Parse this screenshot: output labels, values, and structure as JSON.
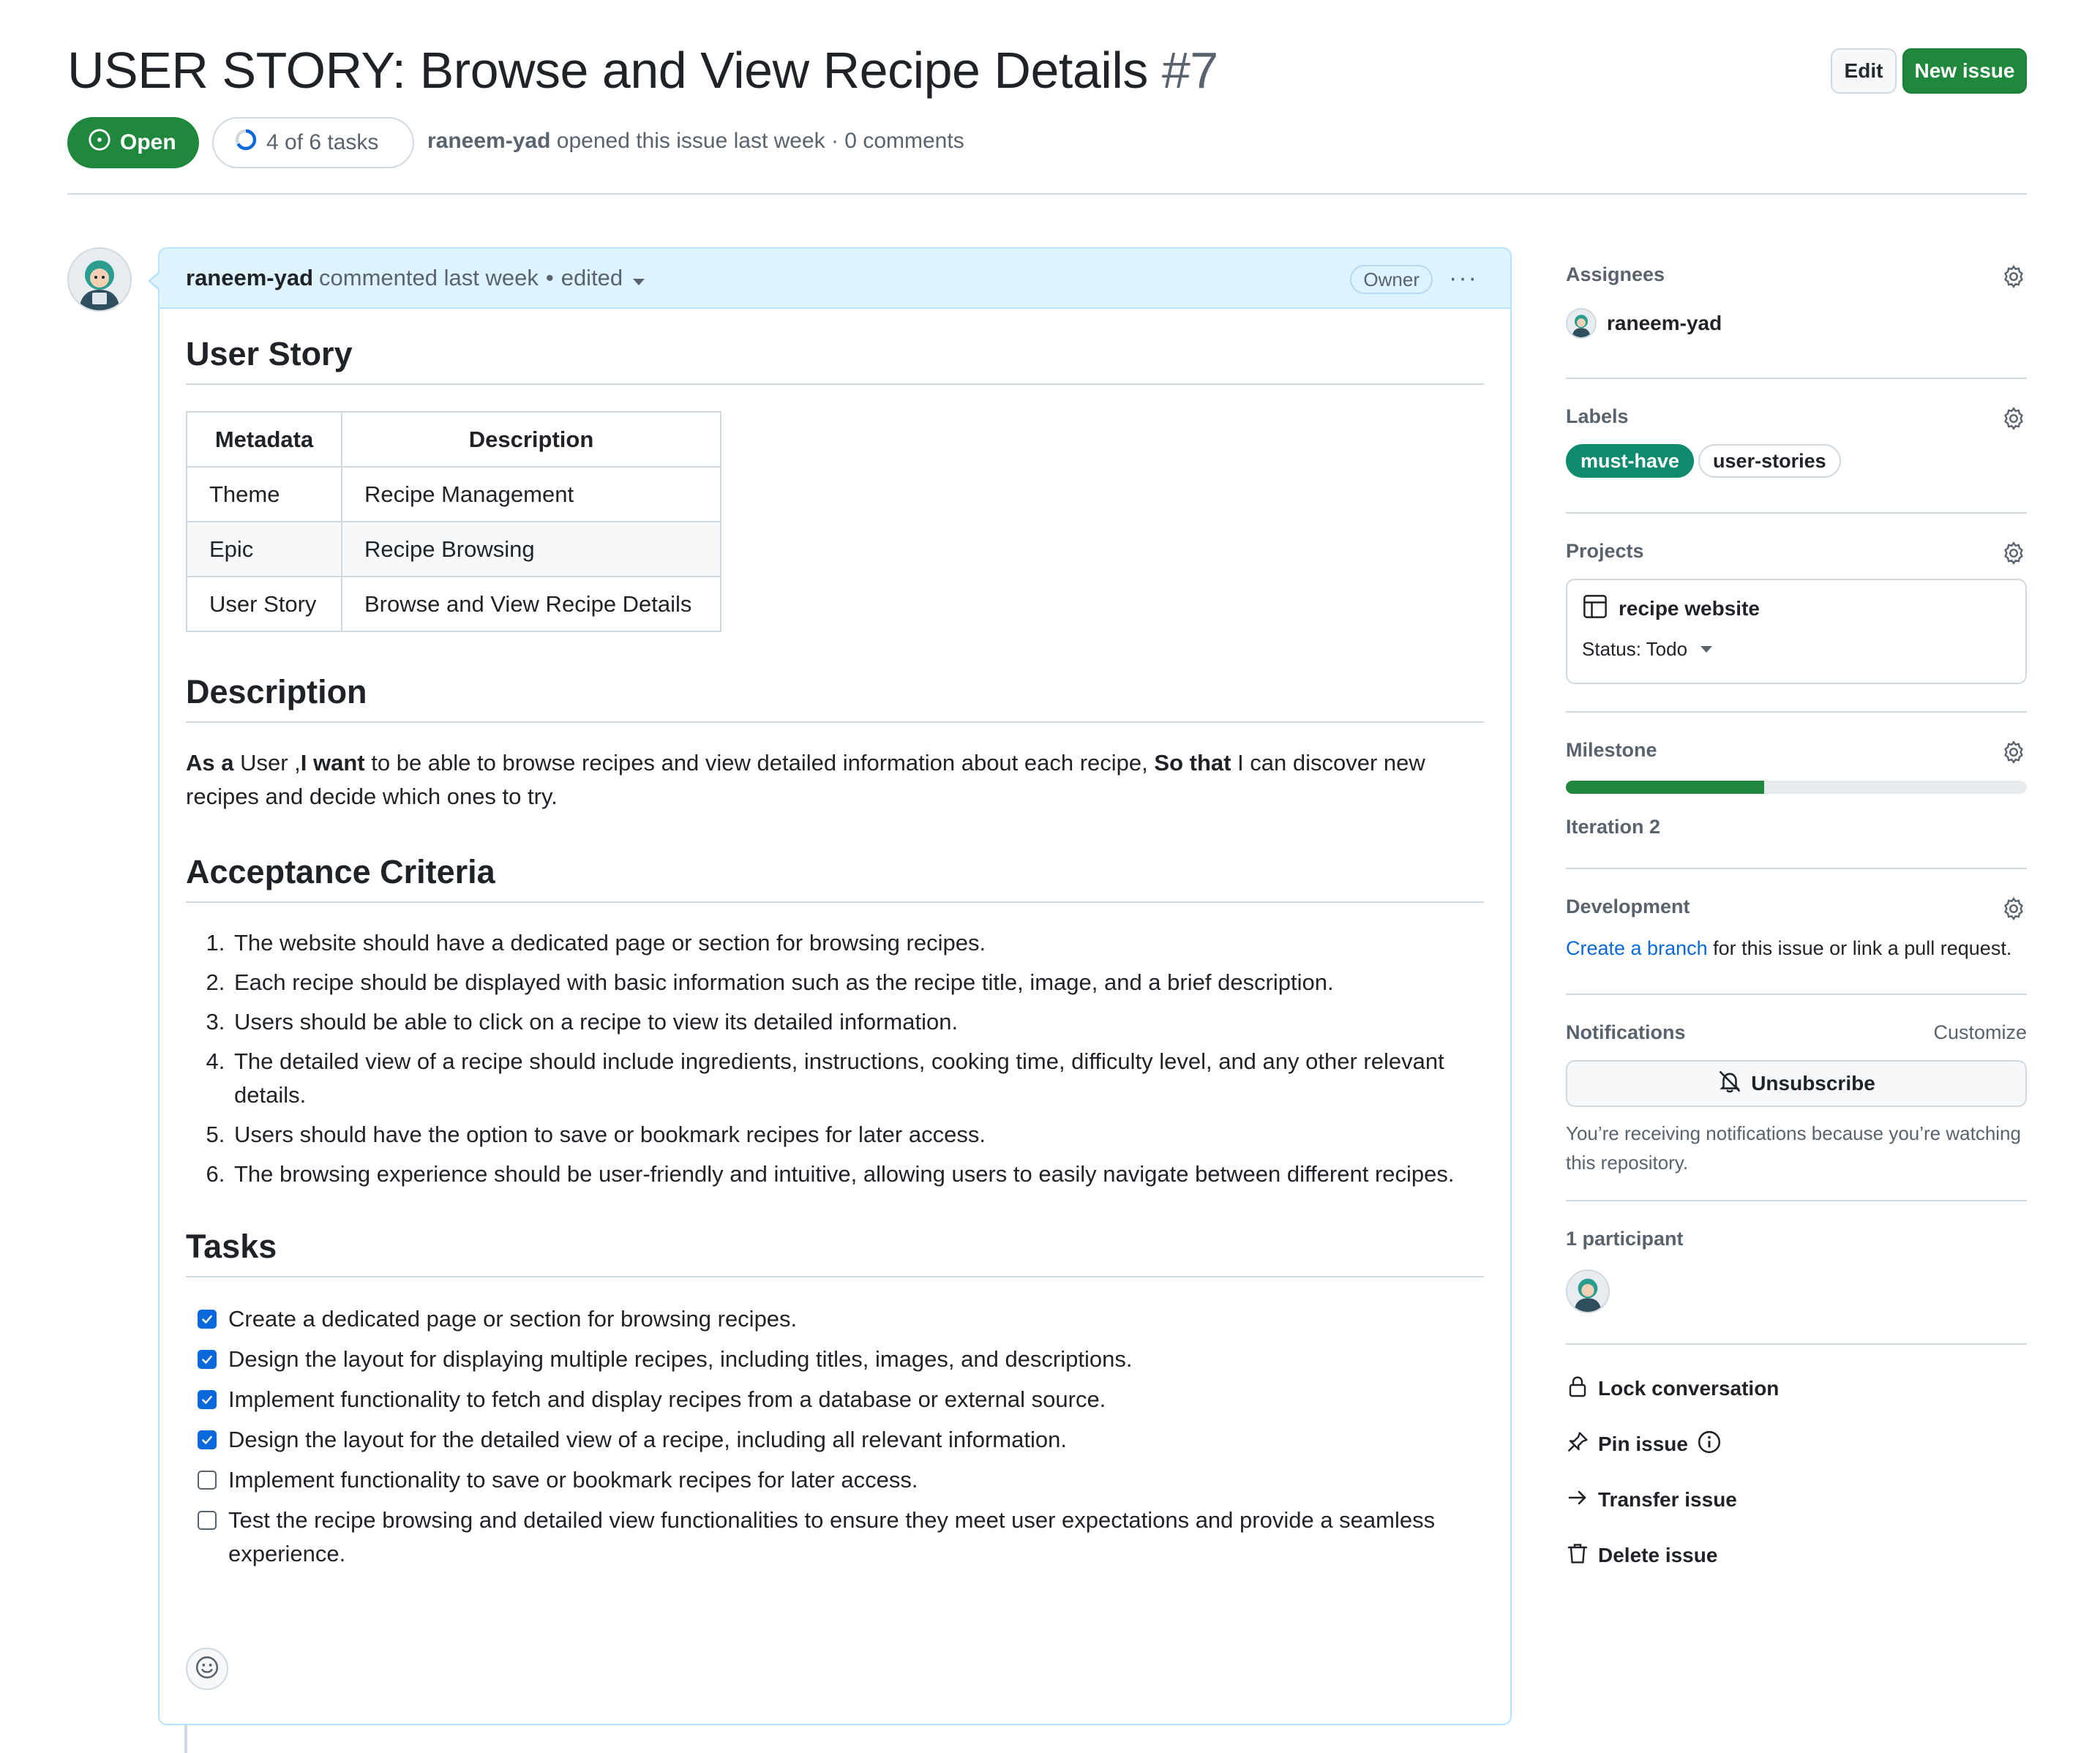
{
  "header": {
    "title": "USER STORY: Browse and View Recipe Details",
    "number": "#7",
    "edit_label": "Edit",
    "new_issue_label": "New issue",
    "state_label": "Open",
    "tasks_label": "4 of 6 tasks",
    "tasks_done": 4,
    "tasks_total": 6,
    "author": "raneem-yad",
    "opened_text": "opened this issue last week · 0 comments"
  },
  "comment": {
    "author": "raneem-yad",
    "time_text": "commented last week",
    "edited_label": "edited",
    "role_badge": "Owner",
    "more_label": "···",
    "user_story_heading": "User Story",
    "table": {
      "headers": [
        "Metadata",
        "Description"
      ],
      "rows": [
        [
          "Theme",
          "Recipe Management"
        ],
        [
          "Epic",
          "Recipe Browsing"
        ],
        [
          "User Story",
          "Browse and View Recipe Details"
        ]
      ]
    },
    "description_heading": "Description",
    "description": {
      "as_a": "As a",
      "role": " User ,",
      "i_want": "I want",
      "want_text": " to be able to browse recipes and view detailed information about each recipe, ",
      "so_that": "So that",
      "so_text": " I can discover new recipes and decide which ones to try."
    },
    "acceptance_heading": "Acceptance Criteria",
    "criteria": [
      "The website should have a dedicated page or section for browsing recipes.",
      "Each recipe should be displayed with basic information such as the recipe title, image, and a brief description.",
      "Users should be able to click on a recipe to view its detailed information.",
      "The detailed view of a recipe should include ingredients, instructions, cooking time, difficulty level, and any other relevant details.",
      "Users should have the option to save or bookmark recipes for later access.",
      "The browsing experience should be user-friendly and intuitive, allowing users to easily navigate between different recipes."
    ],
    "tasks_heading": "Tasks",
    "tasks": [
      {
        "text": "Create a dedicated page or section for browsing recipes.",
        "checked": true
      },
      {
        "text": "Design the layout for displaying multiple recipes, including titles, images, and descriptions.",
        "checked": true
      },
      {
        "text": "Implement functionality to fetch and display recipes from a database or external source.",
        "checked": true
      },
      {
        "text": "Design the layout for the detailed view of a recipe, including all relevant information.",
        "checked": true
      },
      {
        "text": "Implement functionality to save or bookmark recipes for later access.",
        "checked": false
      },
      {
        "text": "Test the recipe browsing and detailed view functionalities to ensure they meet user expectations and provide a seamless experience.",
        "checked": false
      }
    ]
  },
  "sidebar": {
    "assignees_title": "Assignees",
    "assignee_name": "raneem-yad",
    "labels_title": "Labels",
    "labels": [
      {
        "name": "must-have",
        "bg": "#0e8a6f",
        "fg": "#ffffff"
      },
      {
        "name": "user-stories",
        "bg": "#ffffff",
        "fg": "#1f2328"
      }
    ],
    "projects_title": "Projects",
    "project_name": "recipe website",
    "project_status": "Status: Todo",
    "milestone_title": "Milestone",
    "milestone_progress": 0.43,
    "milestone_name": "Iteration 2",
    "development_title": "Development",
    "dev_link": "Create a branch",
    "dev_text": " for this issue or link a pull request.",
    "notifications_title": "Notifications",
    "customize_label": "Customize",
    "unsubscribe_label": "Unsubscribe",
    "notif_reason": "You’re receiving notifications because you’re watching this repository.",
    "participants_title": "1 participant",
    "actions": {
      "lock": "Lock conversation",
      "pin": "Pin issue",
      "transfer": "Transfer issue",
      "delete": "Delete issue"
    }
  },
  "icons": {
    "open": "issue-opened-icon",
    "progress": "progress-ring-icon",
    "gear": "gear-icon",
    "table": "table-icon",
    "bell_slash": "bell-slash-icon",
    "lock": "lock-icon",
    "pin": "pin-icon",
    "info": "info-icon",
    "arrow_right": "arrow-right-icon",
    "trash": "trash-icon",
    "smiley": "smiley-icon",
    "check": "check-icon"
  },
  "colors": {
    "primary_green": "#1f883d",
    "link_blue": "#0969da",
    "comment_header_bg": "#ddf4ff",
    "label_must_have": "#0e8a6f"
  }
}
